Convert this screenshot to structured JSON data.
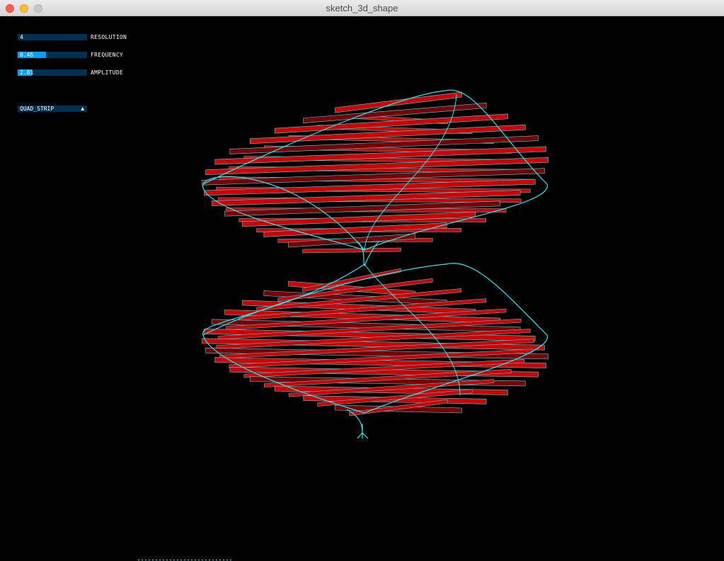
{
  "window": {
    "title": "sketch_3d_shape"
  },
  "controls": {
    "sliders": [
      {
        "value": "4",
        "label": "RESOLUTION",
        "fraction": 0.0
      },
      {
        "value": "0.46",
        "label": "FREQUENCY",
        "fraction": 0.41
      },
      {
        "value": "2.01",
        "label": "AMPLITUDE",
        "fraction": 0.2
      }
    ],
    "dropdown": {
      "selected": "QUAD_STRIP",
      "arrow": "▲"
    }
  },
  "colors": {
    "background": "#000000",
    "control_bg": "#003052",
    "control_fill": "#00a0ff",
    "control_text": "#ffffff",
    "face": "#d10000",
    "face_dark": "#7a0000",
    "edge": "#33e6f0"
  },
  "icons": {
    "close": "close-icon",
    "minimize": "minimize-icon",
    "maximize": "maximize-icon",
    "dropdown": "chevron-up-icon"
  }
}
